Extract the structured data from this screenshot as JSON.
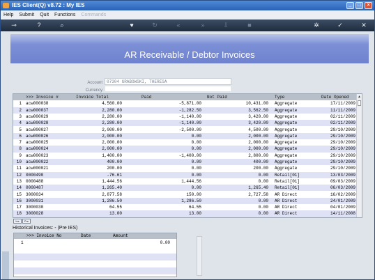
{
  "window": {
    "title": "IES Client(Q) v8.72 : My IES"
  },
  "menu": [
    "Help",
    "Submit",
    "Quit",
    "Functions",
    "Commands"
  ],
  "banner": {
    "title": "AR Receivable / Debtor Invoices"
  },
  "form": {
    "account_label": "Account",
    "account_value": "07304 GRABOWSKI, THERESA",
    "currency_label": "Currency",
    "currency_value": ""
  },
  "grid": {
    "headers": [
      ">>> Invoice #",
      "Invoice Total",
      "Paid",
      "Not Paid",
      "Type",
      "Date Opened"
    ],
    "rows": [
      [
        "1",
        "acw000038",
        "4,560.00",
        "-5,871.00",
        "10,431.00",
        "Aggregate",
        "17/11/2009"
      ],
      [
        "2",
        "acw000037",
        "2,280.00",
        "-1,282.50",
        "3,562.50",
        "Aggregate",
        "11/11/2009"
      ],
      [
        "3",
        "acw000029",
        "2,280.00",
        "-1,140.00",
        "3,420.00",
        "Aggregate",
        "02/11/2009"
      ],
      [
        "4",
        "acw000028",
        "2,280.00",
        "-1,140.00",
        "3,420.00",
        "Aggregate",
        "02/11/2009"
      ],
      [
        "5",
        "acw000027",
        "2,000.00",
        "-2,500.00",
        "4,500.00",
        "Aggregate",
        "29/10/2009"
      ],
      [
        "6",
        "acw000026",
        "2,000.00",
        "0.00",
        "2,000.00",
        "Aggregate",
        "29/10/2009"
      ],
      [
        "7",
        "acw000025",
        "2,000.00",
        "0.00",
        "2,000.00",
        "Aggregate",
        "29/10/2009"
      ],
      [
        "8",
        "acw000024",
        "2,000.00",
        "0.00",
        "2,000.00",
        "Aggregate",
        "29/10/2009"
      ],
      [
        "9",
        "acw000023",
        "1,400.00",
        "-1,400.00",
        "2,800.00",
        "Aggregate",
        "29/10/2009"
      ],
      [
        "10",
        "acw000022",
        "400.00",
        "0.00",
        "400.00",
        "Aggregate",
        "29/10/2009"
      ],
      [
        "11",
        "acw000021",
        "200.00",
        "0.00",
        "200.00",
        "Aggregate",
        "29/10/2009"
      ],
      [
        "12",
        "0000490",
        "-76.61",
        "0.00",
        "0.00",
        "Retail[01]",
        "13/03/2009"
      ],
      [
        "13",
        "0000488",
        "1,444.56",
        "1,444.56",
        "0.00",
        "Retail[01]",
        "09/03/2009"
      ],
      [
        "14",
        "0000487",
        "1,265.40",
        "0.00",
        "1,265.40",
        "Retail[01]",
        "06/03/2009"
      ],
      [
        "15",
        "3000034",
        "2,877.58",
        "150.00",
        "2,727.58",
        "AR Direct",
        "16/02/2009"
      ],
      [
        "16",
        "3000031",
        "1,286.50",
        "1,286.50",
        "0.00",
        "AR Direct",
        "24/01/2009"
      ],
      [
        "17",
        "3000030",
        "64.55",
        "64.55",
        "0.00",
        "AR Direct",
        "04/01/2009"
      ],
      [
        "18",
        "3000028",
        "13.00",
        "13.00",
        "0.00",
        "AR Direct",
        "14/11/2008"
      ]
    ]
  },
  "tabs": [
    "Ies",
    "Pre"
  ],
  "history": {
    "title": "Historical Invoices: - (Pre IES)",
    "headers": [
      ">>> Invoice No",
      "Date",
      "Amount"
    ],
    "rows": [
      [
        "1",
        "",
        "",
        "0.00"
      ]
    ]
  }
}
